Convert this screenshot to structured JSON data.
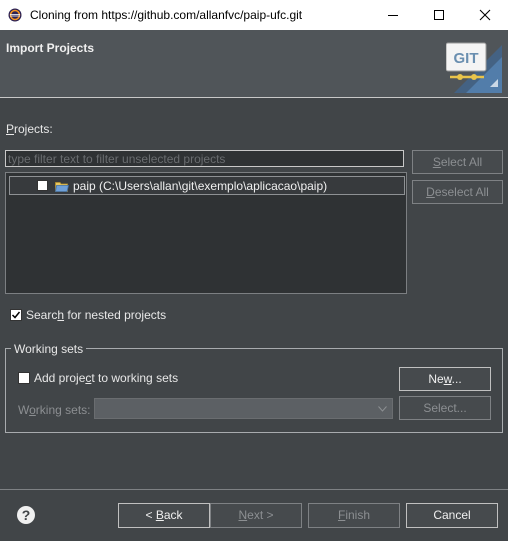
{
  "window": {
    "title": "Cloning from https://github.com/allanfvc/paip-ufc.git",
    "app_icon": "eclipse-icon",
    "controls": [
      "minimize-icon",
      "maximize-icon",
      "close-icon"
    ]
  },
  "header": {
    "page_title": "Import Projects",
    "logo_text": "GIT"
  },
  "projects": {
    "label_prefix": "",
    "label_mnemonic": "P",
    "label_rest": "rojects:",
    "filter_placeholder": "type filter text to filter unselected projects",
    "items": [
      {
        "label": "paip (C:\\Users\\allan\\git\\exemplo\\aplicacao\\paip)",
        "checked": false,
        "icon": "folder-icon"
      }
    ],
    "select_all": {
      "prefix": "",
      "mnemonic": "S",
      "rest": "elect All",
      "enabled": false
    },
    "deselect_all": {
      "prefix": "",
      "mnemonic": "D",
      "rest": "eselect All",
      "enabled": false
    }
  },
  "nested": {
    "checked": true,
    "prefix": "Searc",
    "mnemonic": "h",
    "rest": " for nested projects"
  },
  "working_sets": {
    "group_title": "Working sets",
    "add_checkbox": {
      "checked": false,
      "prefix": "Add proje",
      "mnemonic": "c",
      "rest": "t to working sets"
    },
    "new_button": {
      "prefix": "Ne",
      "mnemonic": "w",
      "rest": "..."
    },
    "label": {
      "prefix": "W",
      "mnemonic": "o",
      "rest": "rking sets:"
    },
    "select_button": {
      "prefix": "",
      "mnemonic": "",
      "rest": "Select...",
      "enabled": false
    }
  },
  "footer": {
    "help_icon": "help-icon",
    "back": {
      "prefix": "< ",
      "mnemonic": "B",
      "rest": "ack",
      "enabled": true
    },
    "next": {
      "prefix": "",
      "mnemonic": "N",
      "rest": "ext >",
      "enabled": false
    },
    "finish": {
      "prefix": "",
      "mnemonic": "F",
      "rest": "inish",
      "enabled": false
    },
    "cancel": {
      "label": "Cancel",
      "enabled": true
    }
  },
  "colors": {
    "background": "#414548",
    "header": "#505559",
    "list_background": "#2f3234",
    "text": "#e8e8e8",
    "disabled_text": "#8c8f92"
  }
}
